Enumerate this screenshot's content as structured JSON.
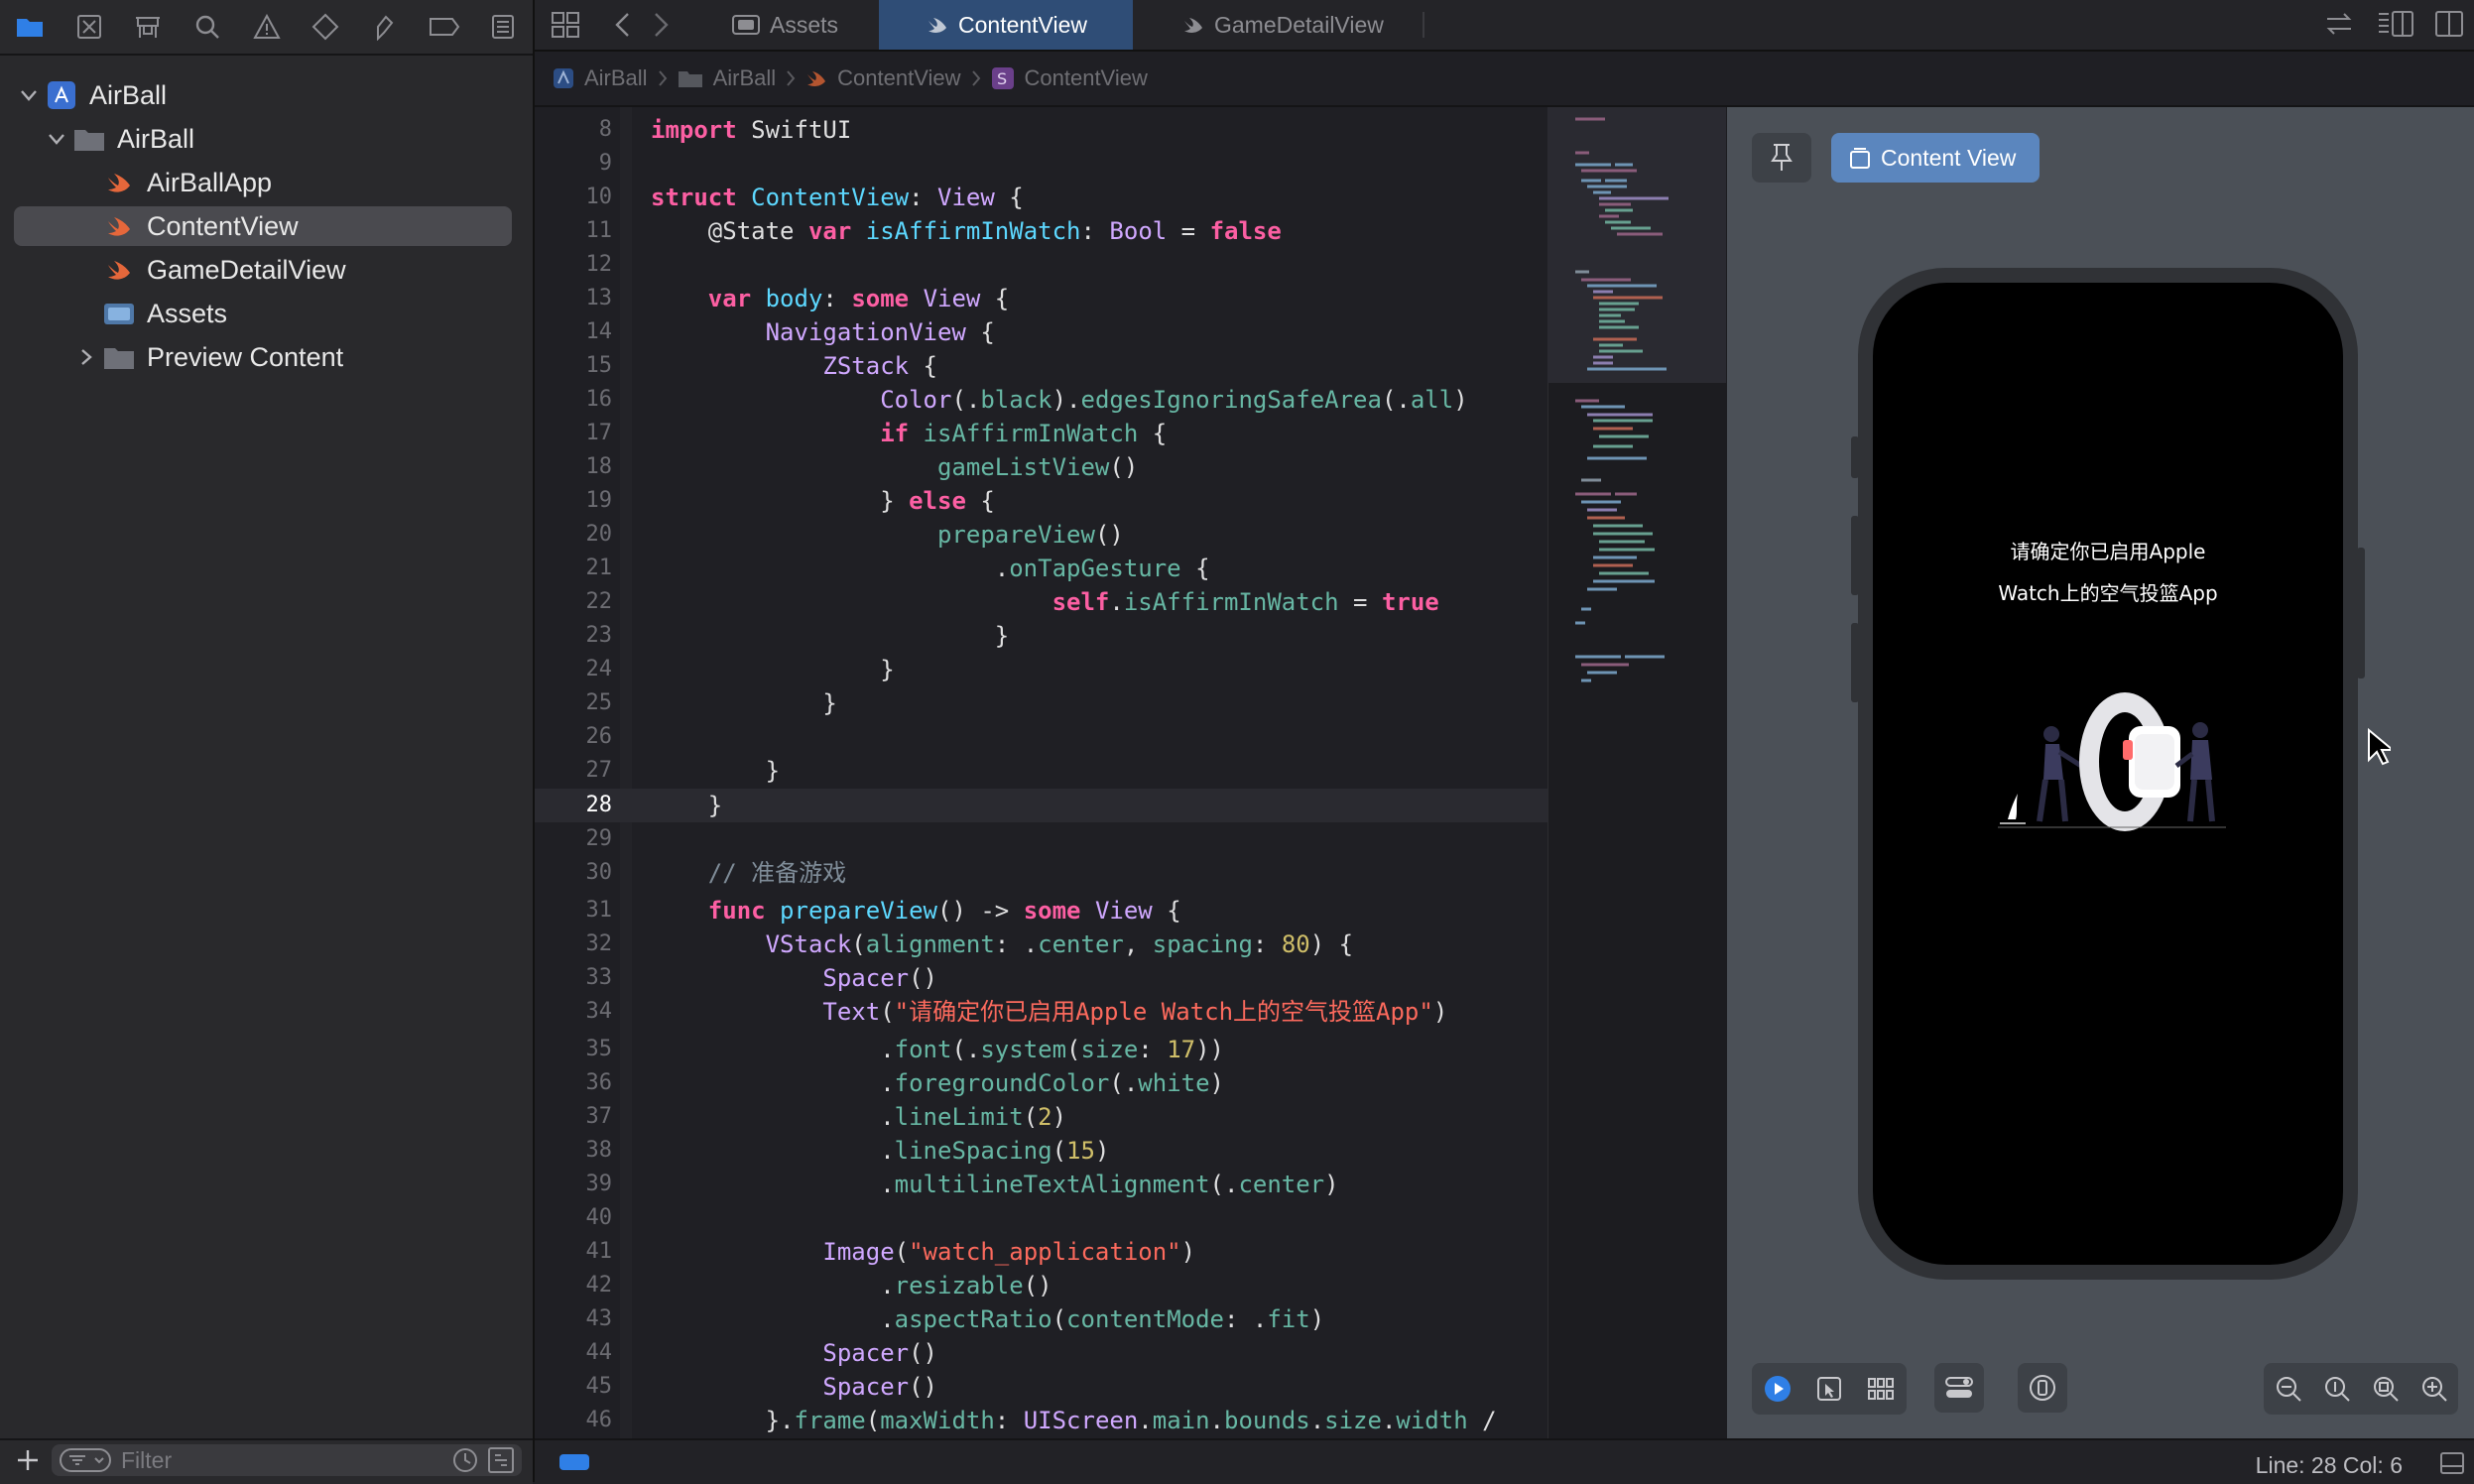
{
  "navigator": {
    "project": "AirBall",
    "group": "AirBall",
    "files": [
      "AirBallApp",
      "ContentView",
      "GameDetailView",
      "Assets",
      "Preview Content"
    ],
    "selected": "ContentView",
    "filter_placeholder": "Filter"
  },
  "tabs": [
    {
      "label": "Assets",
      "active": false
    },
    {
      "label": "ContentView",
      "active": true
    },
    {
      "label": "GameDetailView",
      "active": false
    }
  ],
  "jumpbar": [
    "AirBall",
    "AirBall",
    "ContentView",
    "ContentView"
  ],
  "editor": {
    "current_line": 28,
    "line_numbers": [
      "8",
      "9",
      "10",
      "11",
      "12",
      "13",
      "14",
      "15",
      "16",
      "17",
      "18",
      "19",
      "20",
      "21",
      "22",
      "23",
      "24",
      "25",
      "26",
      "27",
      "28",
      "29",
      "30",
      "31",
      "32",
      "33",
      "34",
      "35",
      "36",
      "37",
      "38",
      "39",
      "40",
      "41",
      "42",
      "43",
      "44",
      "45",
      "46"
    ]
  },
  "preview": {
    "chip_label": "Content View",
    "prompt_line1": "请确定你已启用Apple",
    "prompt_line2": "Watch上的空气投篮App"
  },
  "status": {
    "line_col": "Line: 28  Col: 6"
  },
  "colors": {
    "accent": "#2f4d76",
    "keyword": "#fc5fa3",
    "type": "#5dd8ff",
    "string": "#fc6a5d",
    "number": "#d0bf69"
  }
}
